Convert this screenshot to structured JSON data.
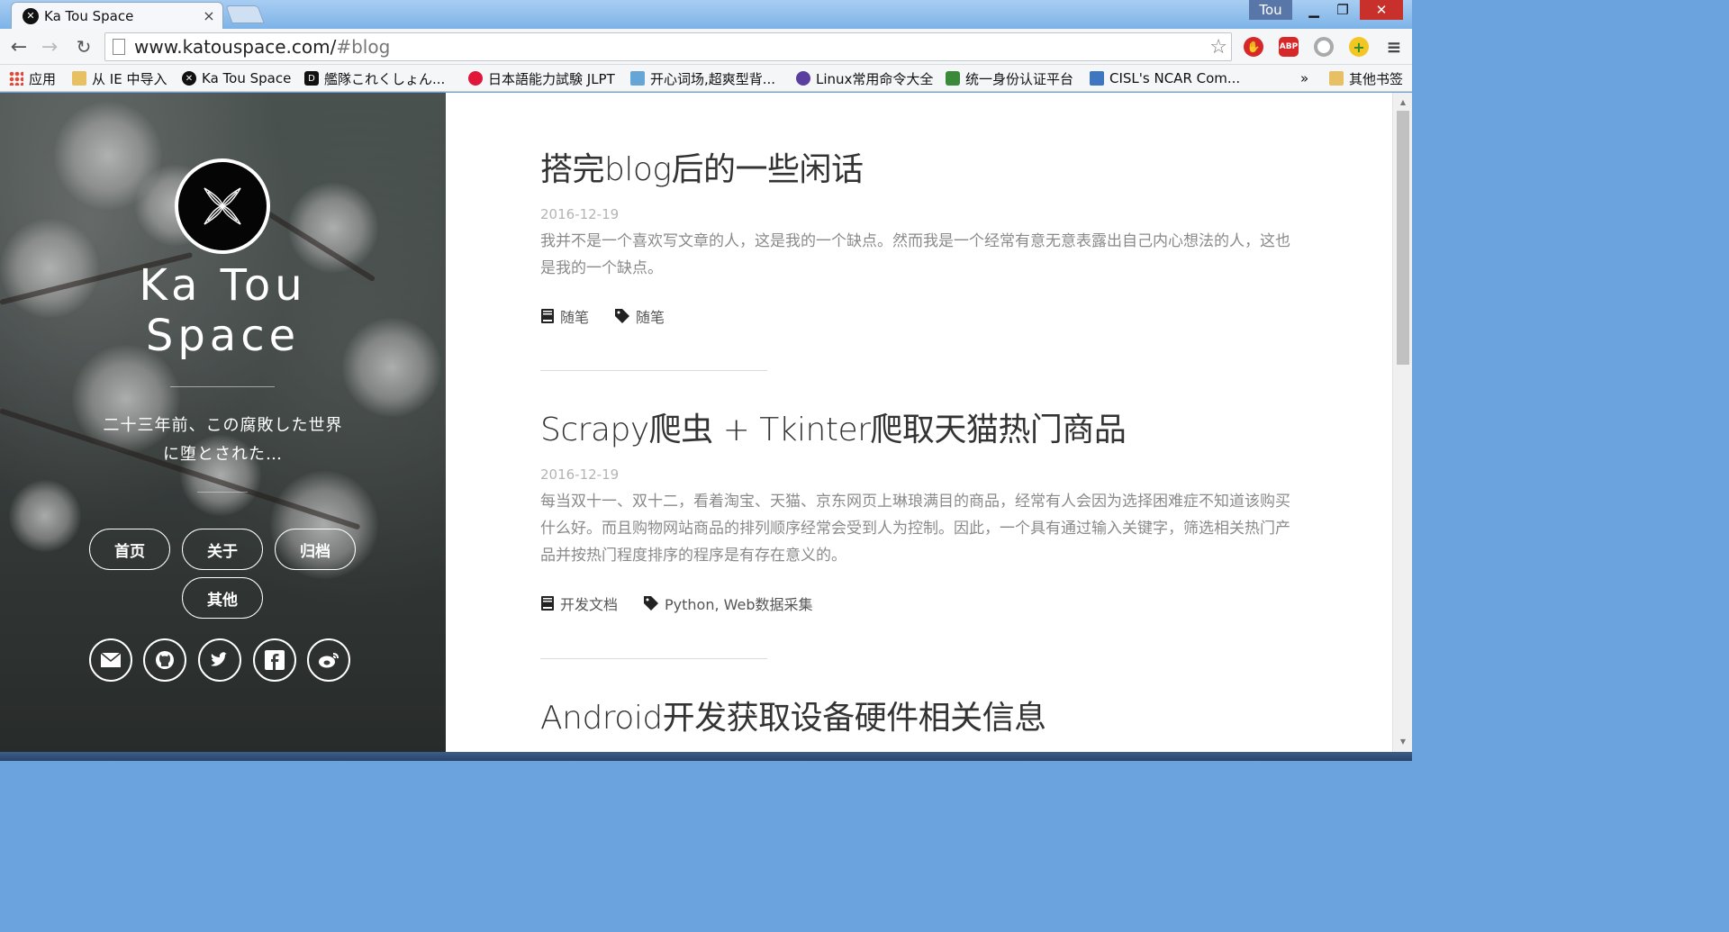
{
  "browser": {
    "tab_title": "Ka Tou Space",
    "tab_close": "×",
    "user": "Tou",
    "win_min": "▁",
    "win_max": "❐",
    "win_close": "✕",
    "url_host": "www.katouspace.com/",
    "url_path": "#blog",
    "back": "←",
    "forward": "→",
    "reload": "↻",
    "star": "☆",
    "ext_abp": "ABP",
    "menu": "≡"
  },
  "bookmarks": [
    {
      "label": "应用",
      "icon": "apps-icon"
    },
    {
      "label": "从 IE 中导入",
      "icon": "folder-icon"
    },
    {
      "label": "Ka Tou Space",
      "icon": "katou-icon"
    },
    {
      "label": "艦隊これくしょん...",
      "icon": "dmm-icon"
    },
    {
      "label": "日本語能力試験 JLPT",
      "icon": "jlpt-icon"
    },
    {
      "label": "开心词场,超爽型背...",
      "icon": "hujiang-icon"
    },
    {
      "label": "Linux常用命令大全",
      "icon": "linux-icon"
    },
    {
      "label": "统一身份认证平台",
      "icon": "auth-icon"
    },
    {
      "label": "CISL's NCAR Com...",
      "icon": "cisl-icon"
    }
  ],
  "bookmarks_more": "»",
  "bookmarks_other": "其他书签",
  "sidebar": {
    "title_line1": "Ka Tou",
    "title_line2": "Space",
    "tagline": "二十三年前、この腐敗した世界に堕とされた…",
    "nav": [
      "首页",
      "关于",
      "归档",
      "其他"
    ],
    "social": [
      "mail-icon",
      "github-icon",
      "twitter-icon",
      "facebook-icon",
      "weibo-icon"
    ]
  },
  "posts": [
    {
      "title": "搭完blog后的一些闲话",
      "date": "2016-12-19",
      "excerpt": "我并不是一个喜欢写文章的人，这是我的一个缺点。然而我是一个经常有意无意表露出自己内心想法的人，这也是我的一个缺点。",
      "category": "随笔",
      "tags": "随笔"
    },
    {
      "title": "Scrapy爬虫 + Tkinter爬取天猫热门商品",
      "date": "2016-12-19",
      "excerpt": "每当双十一、双十二，看着淘宝、天猫、京东网页上琳琅满目的商品，经常有人会因为选择困难症不知道该购买什么好。而且购物网站商品的排列顺序经常会受到人为控制。因此，一个具有通过输入关键字，筛选相关热门产品并按热门程度排序的程序是有存在意义的。",
      "category": "开发文档",
      "tags": "Python, Web数据采集"
    },
    {
      "title": "Android开发获取设备硬件相关信息"
    }
  ]
}
